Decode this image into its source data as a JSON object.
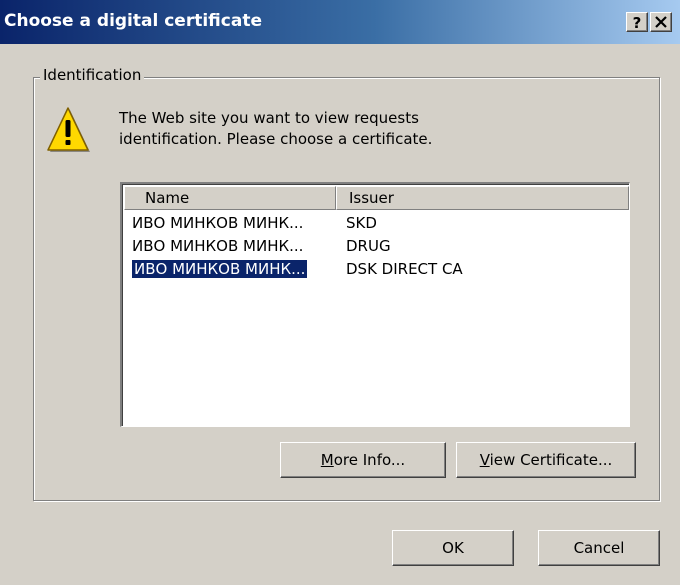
{
  "window": {
    "title": "Choose a digital certificate",
    "help_label": "?",
    "close_label": "✕"
  },
  "group": {
    "legend": "Identification"
  },
  "message": {
    "line1": "The Web site you want to view requests",
    "line2": "identification. Please choose a certificate."
  },
  "list": {
    "columns": [
      "Name",
      "Issuer"
    ],
    "rows": [
      {
        "name": "ИВО МИНКОВ МИНК...",
        "issuer": "SKD",
        "selected": false
      },
      {
        "name": "ИВО МИНКОВ МИНК...",
        "issuer": "DRUG",
        "selected": false
      },
      {
        "name": "ИВО МИНКОВ МИНК...",
        "issuer": "DSK DIRECT CA",
        "selected": true
      }
    ]
  },
  "buttons": {
    "more_info_mnemonic": "M",
    "more_info_rest": "ore Info...",
    "view_cert_mnemonic": "V",
    "view_cert_rest": "iew Certificate...",
    "ok": "OK",
    "cancel": "Cancel"
  },
  "colors": {
    "titlebar_start": "#0a246a",
    "titlebar_end": "#a6caf0",
    "selection": "#0a246a",
    "face": "#d4d0c8"
  },
  "icons": {
    "warning": "warning-icon"
  }
}
